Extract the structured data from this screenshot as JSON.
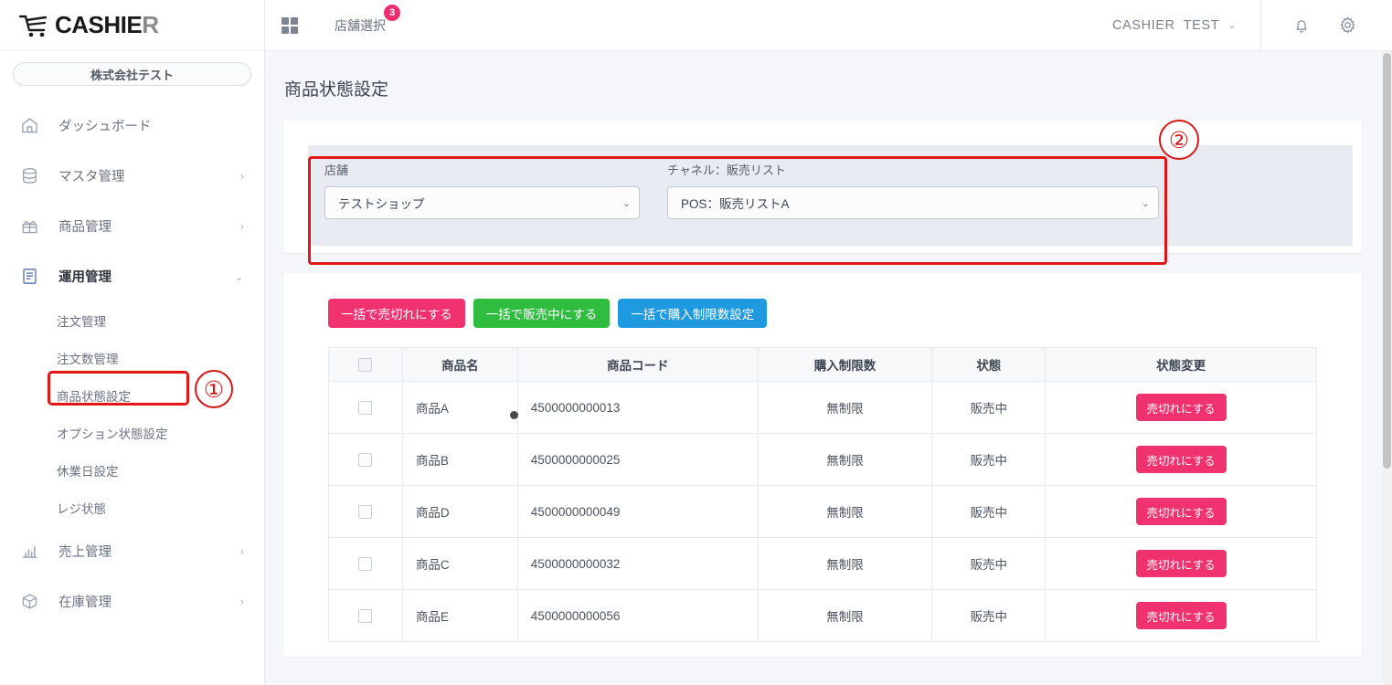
{
  "brand": {
    "name_main": "CASHIE",
    "name_accent": "R",
    "cart_icon": "shopping-cart-icon"
  },
  "sidebar": {
    "company_badge": "株式会社テスト",
    "items": [
      {
        "label": "ダッシュボード",
        "icon": "home-icon",
        "chevron": "",
        "active": false
      },
      {
        "label": "マスタ管理",
        "icon": "database-icon",
        "chevron": "›",
        "active": false
      },
      {
        "label": "商品管理",
        "icon": "gift-icon",
        "chevron": "›",
        "active": false
      },
      {
        "label": "運用管理",
        "icon": "clipboard-icon",
        "chevron": "⌄",
        "active": true
      },
      {
        "label": "売上管理",
        "icon": "bar-chart-icon",
        "chevron": "›",
        "active": false
      },
      {
        "label": "在庫管理",
        "icon": "box-icon",
        "chevron": "›",
        "active": false
      }
    ],
    "subitems": [
      {
        "label": "注文管理"
      },
      {
        "label": "注文数管理"
      },
      {
        "label": "商品状態設定"
      },
      {
        "label": "オプション状態設定"
      },
      {
        "label": "休業日設定"
      },
      {
        "label": "レジ状態"
      }
    ]
  },
  "topbar": {
    "grid_icon": "apps-grid-icon",
    "store_select_label": "店舗選択",
    "store_select_badge": "3",
    "user_org": "CASHIER",
    "user_name": "TEST",
    "user_caret": "⌄",
    "bell_icon": "notification-bell-icon",
    "gear_icon": "settings-gear-icon"
  },
  "page": {
    "title": "商品状態設定"
  },
  "filter": {
    "store": {
      "label": "店舗",
      "value": "テストショップ",
      "caret": "⌄"
    },
    "channel": {
      "label": "チャネル：販売リスト",
      "value": "POS：販売リストA",
      "caret": "⌄"
    }
  },
  "bulk_buttons": [
    {
      "label": "一括で売切れにする",
      "color": "#f0326e"
    },
    {
      "label": "一括で販売中にする",
      "color": "#2fbc3f"
    },
    {
      "label": "一括で購入制限数設定",
      "color": "#1f9ae0"
    }
  ],
  "table": {
    "headers": [
      "",
      "商品名",
      "商品コード",
      "購入制限数",
      "状態",
      "状態変更"
    ],
    "rows": [
      {
        "name": "商品A",
        "code": "4500000000013",
        "limit": "無制限",
        "state": "販売中",
        "action": "売切れにする"
      },
      {
        "name": "商品B",
        "code": "4500000000025",
        "limit": "無制限",
        "state": "販売中",
        "action": "売切れにする"
      },
      {
        "name": "商品D",
        "code": "4500000000049",
        "limit": "無制限",
        "state": "販売中",
        "action": "売切れにする"
      },
      {
        "name": "商品C",
        "code": "4500000000032",
        "limit": "無制限",
        "state": "販売中",
        "action": "売切れにする"
      },
      {
        "name": "商品E",
        "code": "4500000000056",
        "limit": "無制限",
        "state": "販売中",
        "action": "売切れにする"
      }
    ]
  },
  "annotations": [
    {
      "id": "1",
      "label": "①"
    },
    {
      "id": "2",
      "label": "②"
    }
  ],
  "colors": {
    "accent_pink": "#f0326e",
    "accent_green": "#2fbc3f",
    "accent_blue": "#1f9ae0",
    "annotation_red": "#e11616",
    "filter_panel_bg": "#e9ebf2"
  }
}
